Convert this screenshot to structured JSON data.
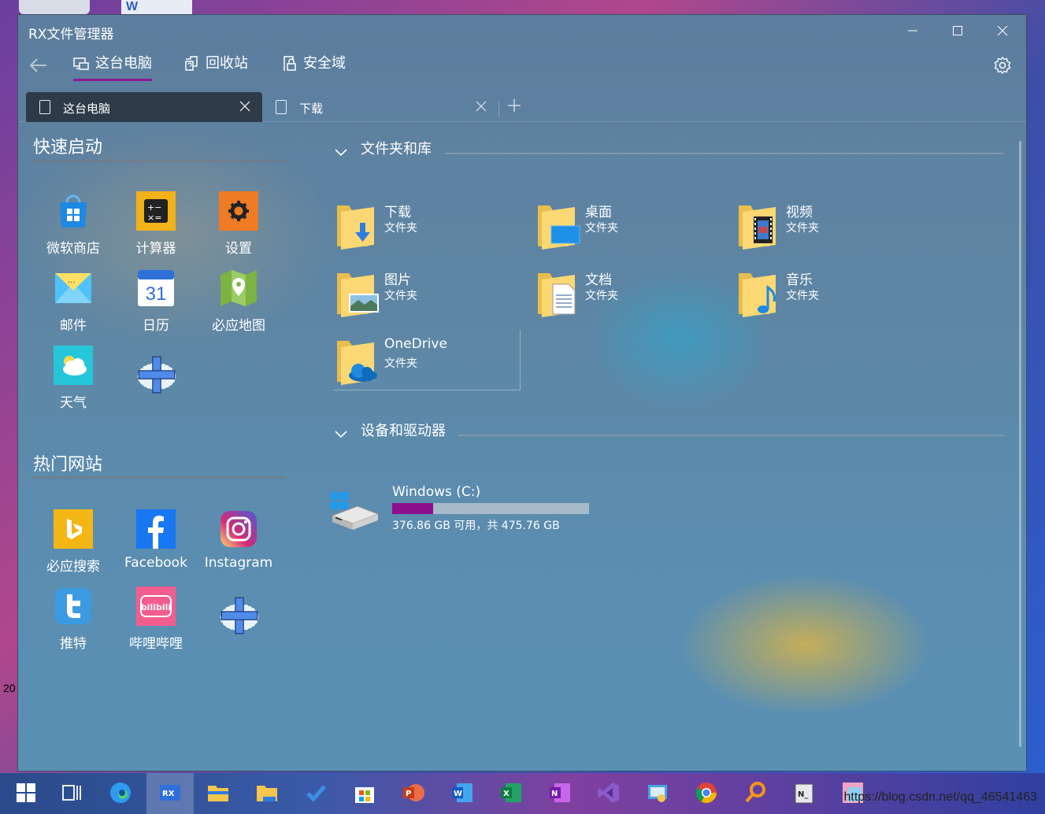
{
  "window": {
    "title": "RX文件管理器"
  },
  "navbar": {
    "items": [
      {
        "label": "这台电脑",
        "icon": "computer-icon",
        "active": true
      },
      {
        "label": "回收站",
        "icon": "recycle-bin-icon",
        "active": false
      },
      {
        "label": "安全域",
        "icon": "lock-icon",
        "active": false
      }
    ],
    "accent": "#8e1a8e"
  },
  "tabs": [
    {
      "label": "这台电脑",
      "active": true
    },
    {
      "label": "下载",
      "active": false
    }
  ],
  "quick_launch": {
    "title": "快速启动",
    "apps": [
      {
        "label": "微软商店",
        "icon": "ms-store-icon"
      },
      {
        "label": "计算器",
        "icon": "calculator-icon"
      },
      {
        "label": "设置",
        "icon": "settings-icon"
      },
      {
        "label": "邮件",
        "icon": "mail-icon"
      },
      {
        "label": "日历",
        "icon": "calendar-icon",
        "badge": "31"
      },
      {
        "label": "必应地图",
        "icon": "maps-icon"
      },
      {
        "label": "天气",
        "icon": "weather-icon"
      }
    ]
  },
  "hot_sites": {
    "title": "热门网站",
    "sites": [
      {
        "label": "必应搜索",
        "icon": "bing-icon"
      },
      {
        "label": "Facebook",
        "icon": "facebook-icon"
      },
      {
        "label": "Instagram",
        "icon": "instagram-icon"
      },
      {
        "label": "推特",
        "icon": "twitter-icon"
      },
      {
        "label": "哔哩哔哩",
        "icon": "bilibili-icon",
        "logo_text": "bilibili"
      }
    ]
  },
  "folders_group": {
    "title": "文件夹和库",
    "folders": [
      {
        "name": "下载",
        "type": "文件夹",
        "icon": "downloads-folder-icon"
      },
      {
        "name": "桌面",
        "type": "文件夹",
        "icon": "desktop-folder-icon"
      },
      {
        "name": "视频",
        "type": "文件夹",
        "icon": "videos-folder-icon"
      },
      {
        "name": "图片",
        "type": "文件夹",
        "icon": "pictures-folder-icon"
      },
      {
        "name": "文档",
        "type": "文件夹",
        "icon": "documents-folder-icon"
      },
      {
        "name": "音乐",
        "type": "文件夹",
        "icon": "music-folder-icon"
      },
      {
        "name": "OneDrive",
        "type": "文件夹",
        "icon": "onedrive-folder-icon"
      }
    ]
  },
  "drives_group": {
    "title": "设备和驱动器",
    "drives": [
      {
        "name": "Windows (C:)",
        "info": "376.86 GB 可用，共 475.76 GB",
        "used_fraction": 0.208
      }
    ]
  },
  "desktop": {
    "side_text": "20",
    "watermark": "https://blog.csdn.net/qq_46541463"
  }
}
